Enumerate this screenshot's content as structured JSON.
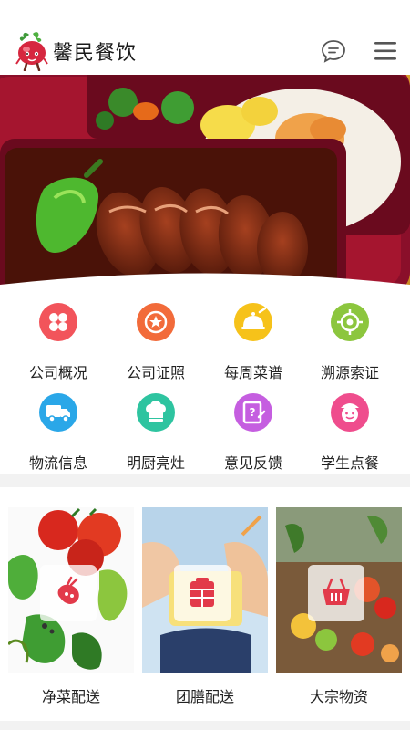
{
  "header": {
    "title": "馨民餐饮",
    "logo_icon": "radish-mascot-icon",
    "message_icon": "chat-bubble-icon",
    "menu_icon": "hamburger-menu-icon"
  },
  "banner": {
    "image": "bento-box-braised-pork-photo"
  },
  "grid": {
    "items": [
      {
        "label": "公司概况",
        "icon": "four-petal-icon",
        "color": "#f2545b"
      },
      {
        "label": "公司证照",
        "icon": "star-badge-icon",
        "color": "#f26b3a"
      },
      {
        "label": "每周菜谱",
        "icon": "dish-cloche-icon",
        "color": "#f6c21a"
      },
      {
        "label": "溯源索证",
        "icon": "crosshair-target-icon",
        "color": "#8cc63e"
      },
      {
        "label": "物流信息",
        "icon": "delivery-truck-icon",
        "color": "#2aa7e8"
      },
      {
        "label": "明厨亮灶",
        "icon": "chef-hat-icon",
        "color": "#2ec4a0"
      },
      {
        "label": "意见反馈",
        "icon": "edit-note-icon",
        "color": "#c55ee0"
      },
      {
        "label": "学生点餐",
        "icon": "student-face-icon",
        "color": "#ef4d8d"
      }
    ]
  },
  "services": {
    "items": [
      {
        "label": "净菜配送",
        "icon": "vegetable-icon"
      },
      {
        "label": "团膳配送",
        "icon": "lunchbox-icon"
      },
      {
        "label": "大宗物资",
        "icon": "shopping-basket-icon"
      }
    ]
  },
  "colors": {
    "accent_red": "#e23a4a",
    "background": "#f2f2f2"
  }
}
